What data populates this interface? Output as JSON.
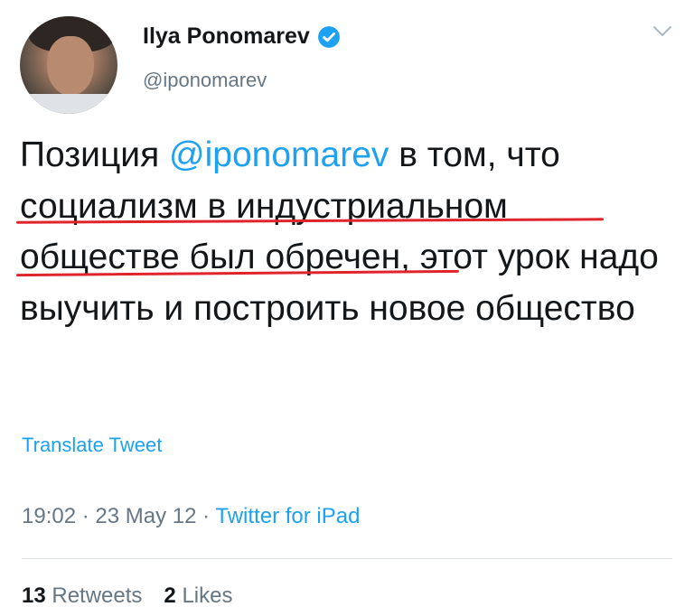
{
  "author": {
    "name": "Ilya Ponomarev",
    "handle": "@iponomarev",
    "verified": true
  },
  "tweet": {
    "text_before": "Позиция ",
    "mention": "@iponomarev",
    "text_after": " в том, что социализм в индустриальном обществе был обречен, этот урок надо выучить и построить новое общество"
  },
  "translate_label": "Translate Tweet",
  "meta": {
    "time": "19:02",
    "date": "23 May 12",
    "separator": "·",
    "source": "Twitter for iPad"
  },
  "stats": {
    "retweets_count": "13",
    "retweets_label": "Retweets",
    "likes_count": "2",
    "likes_label": "Likes"
  },
  "colors": {
    "accent": "#1da1f2",
    "underline": "#e0242b",
    "secondary_text": "#657786"
  }
}
